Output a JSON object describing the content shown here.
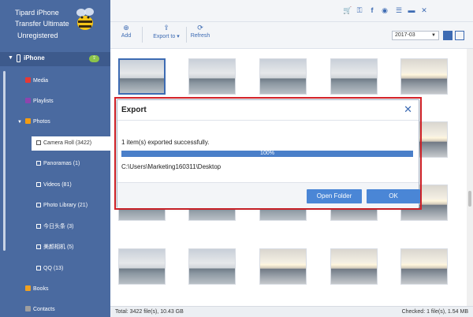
{
  "app": {
    "title_line1": "Tipard iPhone",
    "title_line2": "Transfer Ultimate",
    "title_line3": "Unregistered"
  },
  "sidebar": {
    "device": {
      "name": "iPhone",
      "badge": ""
    },
    "items": [
      {
        "label": "Media",
        "icon": "music-icon",
        "color": "#e53935"
      },
      {
        "label": "Playlists",
        "icon": "playlist-icon",
        "color": "#8e44ad"
      },
      {
        "label": "Photos",
        "icon": "photos-icon",
        "color": "#f39c12"
      }
    ],
    "photo_albums": [
      {
        "label": "Camera Roll (3422)"
      },
      {
        "label": "Panoramas (1)"
      },
      {
        "label": "Videos (81)"
      },
      {
        "label": "Photo Library (21)"
      },
      {
        "label": "今日头条 (3)"
      },
      {
        "label": "美颜相机 (5)"
      },
      {
        "label": "QQ (13)"
      }
    ],
    "bottom_items": [
      {
        "label": "Books",
        "icon": "books-icon",
        "color": "#f0a020"
      },
      {
        "label": "Contacts",
        "icon": "contacts-icon",
        "color": "#9e9e9e"
      }
    ]
  },
  "topbar_icons": [
    "cart-icon",
    "key-icon",
    "facebook-icon",
    "chat-icon",
    "menu-icon",
    "minimize-icon",
    "close-icon"
  ],
  "toolbar": {
    "add_label": "Add",
    "export_label": "Export to",
    "refresh_label": "Refresh",
    "month_value": "2017-03"
  },
  "dialog": {
    "title": "Export",
    "message": "1 item(s) exported successfully.",
    "progress_text": "100%",
    "progress_value": 1.0,
    "path": "C:\\Users\\Marketing160311\\Desktop",
    "open_folder_label": "Open Folder",
    "ok_label": "OK"
  },
  "status": {
    "total": "Total: 3422 file(s), 10.43 GB",
    "checked": "Checked: 1 file(s), 1.54 MB"
  },
  "colors": {
    "sidebar": "#4a6aa0",
    "accent": "#3d6bb3",
    "button": "#4a86d6",
    "highlight_outline": "#d8232a"
  }
}
